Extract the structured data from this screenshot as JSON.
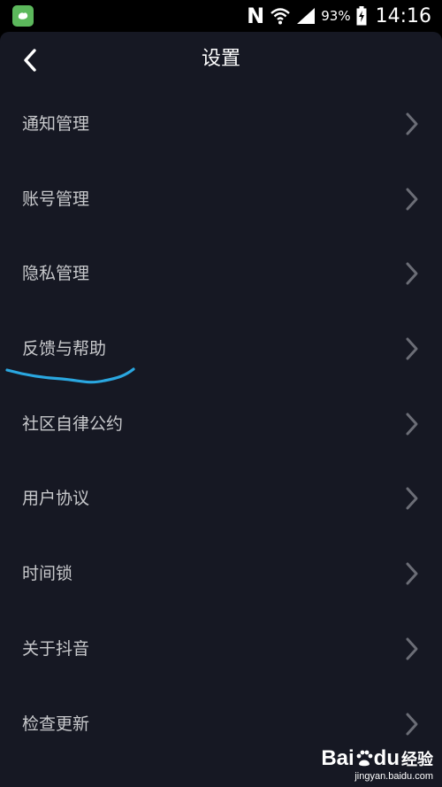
{
  "status_bar": {
    "battery_percent": "93%",
    "time": "14:16",
    "n_label": "N"
  },
  "header": {
    "title": "设置"
  },
  "menu": {
    "items": [
      {
        "label": "通知管理"
      },
      {
        "label": "账号管理"
      },
      {
        "label": "隐私管理"
      },
      {
        "label": "反馈与帮助"
      },
      {
        "label": "社区自律公约"
      },
      {
        "label": "用户协议"
      },
      {
        "label": "时间锁"
      },
      {
        "label": "关于抖音"
      },
      {
        "label": "检查更新"
      }
    ]
  },
  "watermark": {
    "logo_bai": "Bai",
    "logo_du": "du",
    "logo_cn": "经验",
    "url": "jingyan.baidu.com"
  },
  "colors": {
    "background": "#161823",
    "text": "#c8c9cc",
    "chevron": "#6b6d76",
    "annotation": "#2aa7e0"
  }
}
